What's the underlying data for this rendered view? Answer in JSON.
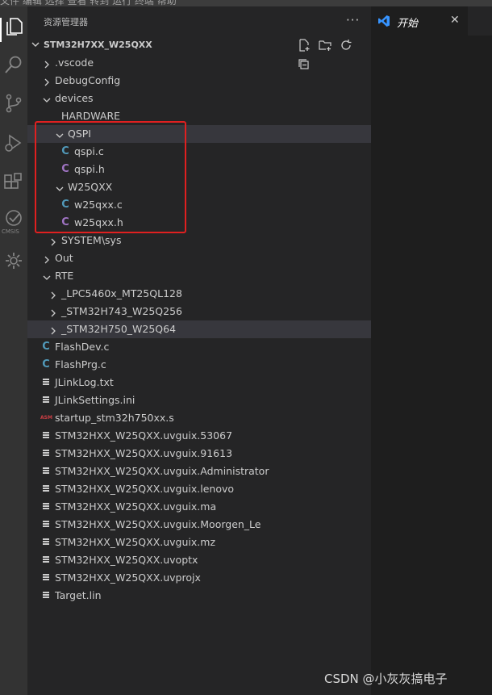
{
  "menu": {
    "fragment": "文件  编辑  选择  查看  转到  运行  终端  帮助"
  },
  "sidebar": {
    "title": "资源管理器",
    "more": "···",
    "section": {
      "title": "STM32H7XX_W25QXX",
      "actions": [
        "new-file-icon",
        "new-folder-icon",
        "refresh-icon",
        "collapse-all-icon"
      ]
    }
  },
  "tree": [
    {
      "label": ".vscode",
      "kind": "folder",
      "depth": 0,
      "open": false
    },
    {
      "label": "DebugConfig",
      "kind": "folder",
      "depth": 0,
      "open": false
    },
    {
      "label": "devices",
      "kind": "folder",
      "depth": 0,
      "open": true
    },
    {
      "label": "HARDWARE",
      "kind": "folder",
      "depth": 1,
      "open": true,
      "noTwist": true
    },
    {
      "label": "QSPI",
      "kind": "folder",
      "depth": 2,
      "open": true,
      "selected": true
    },
    {
      "label": "qspi.c",
      "kind": "c",
      "depth": 3
    },
    {
      "label": "qspi.h",
      "kind": "h",
      "depth": 3
    },
    {
      "label": "W25QXX",
      "kind": "folder",
      "depth": 2,
      "open": true
    },
    {
      "label": "w25qxx.c",
      "kind": "c",
      "depth": 3
    },
    {
      "label": "w25qxx.h",
      "kind": "h",
      "depth": 3
    },
    {
      "label": "SYSTEM\\sys",
      "kind": "folder",
      "depth": 1,
      "open": false
    },
    {
      "label": "Out",
      "kind": "folder",
      "depth": 0,
      "open": false
    },
    {
      "label": "RTE",
      "kind": "folder",
      "depth": 0,
      "open": true
    },
    {
      "label": "_LPC5460x_MT25QL128",
      "kind": "folder",
      "depth": 1,
      "open": false
    },
    {
      "label": "_STM32H743_W25Q256",
      "kind": "folder",
      "depth": 1,
      "open": false
    },
    {
      "label": "_STM32H750_W25Q64",
      "kind": "folder",
      "depth": 1,
      "open": false,
      "hover": true
    },
    {
      "label": "FlashDev.c",
      "kind": "c",
      "depth": 0
    },
    {
      "label": "FlashPrg.c",
      "kind": "c",
      "depth": 0
    },
    {
      "label": "JLinkLog.txt",
      "kind": "doc",
      "depth": 0
    },
    {
      "label": "JLinkSettings.ini",
      "kind": "doc",
      "depth": 0
    },
    {
      "label": "startup_stm32h750xx.s",
      "kind": "asm",
      "depth": 0
    },
    {
      "label": "STM32HXX_W25QXX.uvguix.53067",
      "kind": "doc",
      "depth": 0
    },
    {
      "label": "STM32HXX_W25QXX.uvguix.91613",
      "kind": "doc",
      "depth": 0
    },
    {
      "label": "STM32HXX_W25QXX.uvguix.Administrator",
      "kind": "doc",
      "depth": 0
    },
    {
      "label": "STM32HXX_W25QXX.uvguix.lenovo",
      "kind": "doc",
      "depth": 0
    },
    {
      "label": "STM32HXX_W25QXX.uvguix.ma",
      "kind": "doc",
      "depth": 0
    },
    {
      "label": "STM32HXX_W25QXX.uvguix.Moorgen_Le",
      "kind": "doc",
      "depth": 0
    },
    {
      "label": "STM32HXX_W25QXX.uvguix.mz",
      "kind": "doc",
      "depth": 0
    },
    {
      "label": "STM32HXX_W25QXX.uvoptx",
      "kind": "doc",
      "depth": 0
    },
    {
      "label": "STM32HXX_W25QXX.uvprojx",
      "kind": "doc",
      "depth": 0
    },
    {
      "label": "Target.lin",
      "kind": "doc",
      "depth": 0
    }
  ],
  "icons": {
    "c": "C",
    "h": "C",
    "asm": "ASM"
  },
  "activitybar": {
    "items": [
      "explorer-icon",
      "search-icon",
      "source-control-icon",
      "run-debug-icon",
      "extensions-icon",
      "cmsis-icon",
      "settings-gear-icon"
    ],
    "cmsis_label": "CMSIS"
  },
  "editor": {
    "tab_label": "开始",
    "close": "✕"
  },
  "watermark": "CSDN @小灰灰搞电子",
  "colors": {
    "c_icon": "#519aba",
    "h_icon": "#a074c4",
    "asm_icon": "#cc3e44",
    "highlight_box": "#e02020"
  }
}
